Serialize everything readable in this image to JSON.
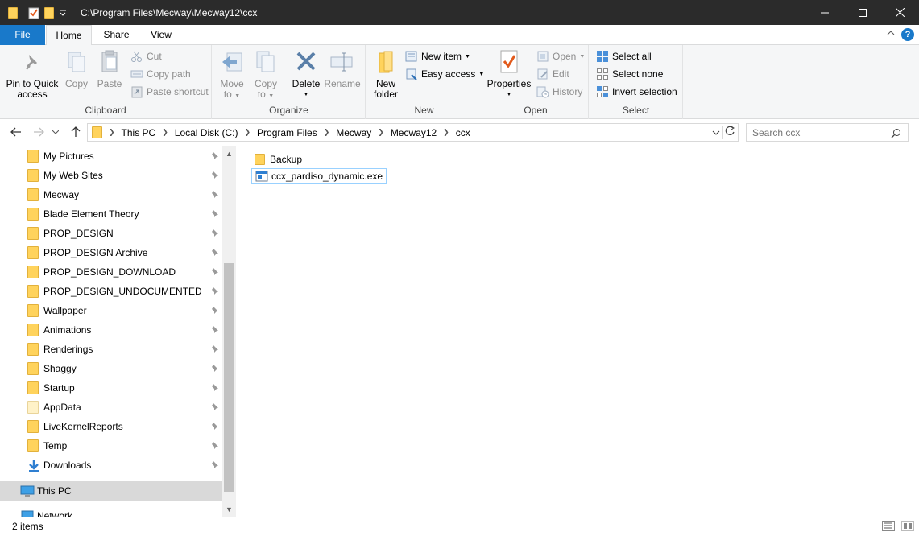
{
  "window": {
    "title": "C:\\Program Files\\Mecway\\Mecway12\\ccx"
  },
  "tabs": {
    "file": "File",
    "home": "Home",
    "share": "Share",
    "view": "View"
  },
  "ribbon": {
    "clipboard": {
      "label": "Clipboard",
      "pin_line1": "Pin to Quick",
      "pin_line2": "access",
      "copy": "Copy",
      "paste": "Paste",
      "cut": "Cut",
      "copy_path": "Copy path",
      "paste_shortcut": "Paste shortcut"
    },
    "organize": {
      "label": "Organize",
      "move_to_line1": "Move",
      "move_to_line2": "to",
      "copy_to_line1": "Copy",
      "copy_to_line2": "to",
      "delete": "Delete",
      "rename": "Rename"
    },
    "new": {
      "label": "New",
      "new_folder_line1": "New",
      "new_folder_line2": "folder",
      "new_item": "New item",
      "easy_access": "Easy access"
    },
    "open": {
      "label": "Open",
      "properties": "Properties",
      "open": "Open",
      "edit": "Edit",
      "history": "History"
    },
    "select": {
      "label": "Select",
      "select_all": "Select all",
      "select_none": "Select none",
      "invert_selection": "Invert selection"
    }
  },
  "address": {
    "crumbs": [
      "This PC",
      "Local Disk (C:)",
      "Program Files",
      "Mecway",
      "Mecway12",
      "ccx"
    ],
    "search_placeholder": "Search ccx"
  },
  "nav": {
    "quick_access": [
      {
        "label": "My Pictures"
      },
      {
        "label": "My Web Sites"
      },
      {
        "label": "Mecway"
      },
      {
        "label": "Blade Element Theory"
      },
      {
        "label": "PROP_DESIGN"
      },
      {
        "label": "PROP_DESIGN Archive"
      },
      {
        "label": "PROP_DESIGN_DOWNLOAD"
      },
      {
        "label": "PROP_DESIGN_UNDOCUMENTED"
      },
      {
        "label": "Wallpaper"
      },
      {
        "label": "Animations"
      },
      {
        "label": "Renderings"
      },
      {
        "label": "Shaggy"
      },
      {
        "label": "Startup"
      },
      {
        "label": "AppData"
      },
      {
        "label": "LiveKernelReports"
      },
      {
        "label": "Temp"
      },
      {
        "label": "Downloads"
      }
    ],
    "this_pc": "This PC",
    "network": "Network"
  },
  "files": [
    {
      "name": "Backup",
      "type": "folder"
    },
    {
      "name": "ccx_pardiso_dynamic.exe",
      "type": "exe"
    }
  ],
  "status": {
    "count": "2 items"
  },
  "colors": {
    "accent": "#1979ca",
    "folder": "#ffd35c",
    "titlebar": "#2b2b2b",
    "selection": "#d9d9d9"
  }
}
